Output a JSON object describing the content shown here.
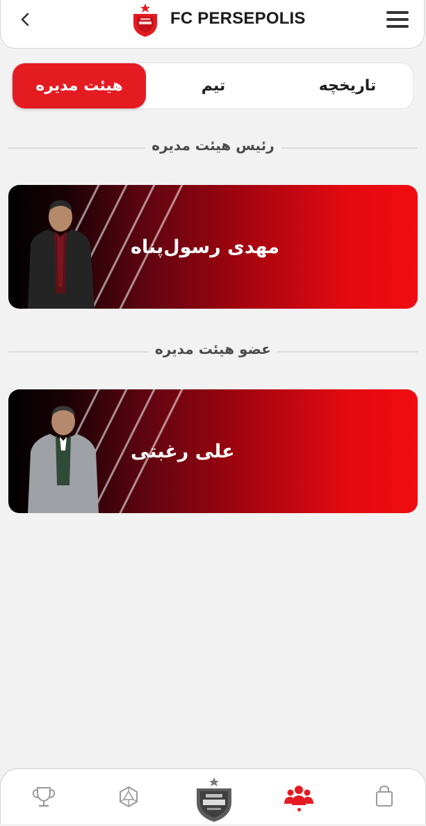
{
  "header": {
    "title": "FC PERSEPOLIS"
  },
  "tabs": [
    {
      "label": "تاریخچه"
    },
    {
      "label": "تیم"
    },
    {
      "label": "هیئت مدیره",
      "active": true
    }
  ],
  "sections": [
    {
      "heading": "رئیس هیئت مدیره",
      "member": {
        "name": "مهدی رسول‌پناه"
      }
    },
    {
      "heading": "عضو هیئت مدیره",
      "member": {
        "name": "علی رغبتی"
      }
    }
  ],
  "bottom_nav": {
    "items": [
      {
        "icon": "trophy-icon"
      },
      {
        "icon": "d20-dice-icon"
      },
      {
        "icon": "club-logo-icon"
      },
      {
        "icon": "people-group-icon",
        "active": true
      },
      {
        "icon": "shopping-bag-icon"
      }
    ]
  },
  "colors": {
    "accent": "#e51b22",
    "background": "#f2f2f2",
    "inactive_icon": "#9a9a9a"
  }
}
